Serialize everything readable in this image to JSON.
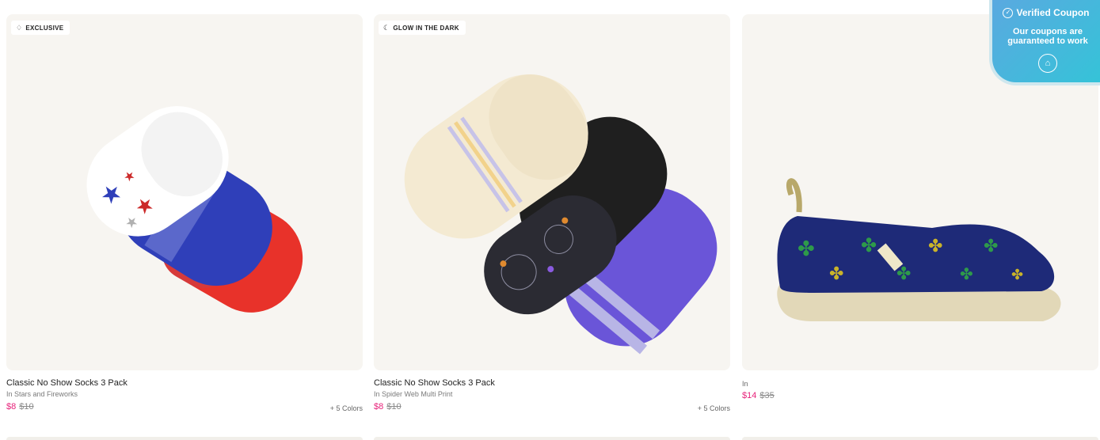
{
  "products": [
    {
      "badge": "EXCLUSIVE",
      "badge_icon": "gem-icon",
      "title": "Classic No Show Socks 3 Pack",
      "subtitle": "In Stars and Fireworks",
      "price": "$8",
      "original_price": "$10",
      "colors": "+ 5 Colors"
    },
    {
      "badge": "GLOW IN THE DARK",
      "badge_icon": "moon-icon",
      "title": "Classic No Show Socks 3 Pack",
      "subtitle": "In Spider Web Multi Print",
      "price": "$8",
      "original_price": "$10",
      "colors": "+ 5 Colors"
    },
    {
      "subtitle": "In",
      "price": "$14",
      "original_price": "$35"
    }
  ],
  "coupon": {
    "title": "Verified Coupon",
    "text": "Our coupons are guaranteed to work",
    "icon": "coupon-hat-icon"
  },
  "colors": {
    "sale_price": "#e7227a",
    "card_bg": "#f7f5f1",
    "coupon_gradient_start": "#5aa9e0",
    "coupon_gradient_end": "#35c3d8"
  }
}
